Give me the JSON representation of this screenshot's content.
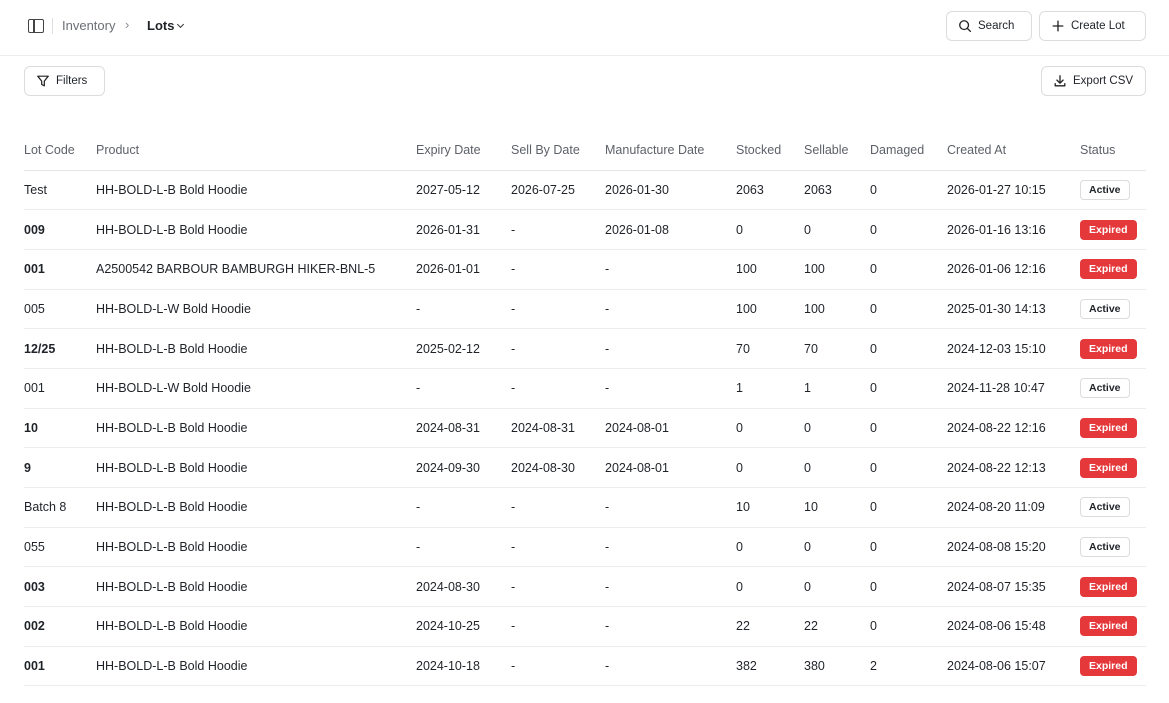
{
  "breadcrumb": {
    "parent": "Inventory",
    "current": "Lots"
  },
  "header_actions": {
    "search_label": "Search",
    "create_label": "Create Lot"
  },
  "toolbar": {
    "filters_label": "Filters",
    "export_label": "Export CSV"
  },
  "table": {
    "columns": [
      "Lot Code",
      "Product",
      "Expiry Date",
      "Sell By Date",
      "Manufacture Date",
      "Stocked",
      "Sellable",
      "Damaged",
      "Created At",
      "Status"
    ],
    "rows": [
      [
        "Test",
        "HH-BOLD-L-B Bold Hoodie",
        "2027-05-12",
        "2026-07-25",
        "2026-01-30",
        "2063",
        "2063",
        "0",
        "2026-01-27 10:15",
        "Active"
      ],
      [
        "009",
        "HH-BOLD-L-B Bold Hoodie",
        "2026-01-31",
        "-",
        "2026-01-08",
        "0",
        "0",
        "0",
        "2026-01-16 13:16",
        "Expired"
      ],
      [
        "001",
        "A2500542 BARBOUR BAMBURGH HIKER-BNL-5",
        "2026-01-01",
        "-",
        "-",
        "100",
        "100",
        "0",
        "2026-01-06 12:16",
        "Expired"
      ],
      [
        "005",
        "HH-BOLD-L-W Bold Hoodie",
        "-",
        "-",
        "-",
        "100",
        "100",
        "0",
        "2025-01-30 14:13",
        "Active"
      ],
      [
        "12/25",
        "HH-BOLD-L-B Bold Hoodie",
        "2025-02-12",
        "-",
        "-",
        "70",
        "70",
        "0",
        "2024-12-03 15:10",
        "Expired"
      ],
      [
        "001",
        "HH-BOLD-L-W Bold Hoodie",
        "-",
        "-",
        "-",
        "1",
        "1",
        "0",
        "2024-11-28 10:47",
        "Active"
      ],
      [
        "10",
        "HH-BOLD-L-B Bold Hoodie",
        "2024-08-31",
        "2024-08-31",
        "2024-08-01",
        "0",
        "0",
        "0",
        "2024-08-22 12:16",
        "Expired"
      ],
      [
        "9",
        "HH-BOLD-L-B Bold Hoodie",
        "2024-09-30",
        "2024-08-30",
        "2024-08-01",
        "0",
        "0",
        "0",
        "2024-08-22 12:13",
        "Expired"
      ],
      [
        "Batch 8",
        "HH-BOLD-L-B Bold Hoodie",
        "-",
        "-",
        "-",
        "10",
        "10",
        "0",
        "2024-08-20 11:09",
        "Active"
      ],
      [
        "055",
        "HH-BOLD-L-B Bold Hoodie",
        "-",
        "-",
        "-",
        "0",
        "0",
        "0",
        "2024-08-08 15:20",
        "Active"
      ],
      [
        "003",
        "HH-BOLD-L-B Bold Hoodie",
        "2024-08-30",
        "-",
        "-",
        "0",
        "0",
        "0",
        "2024-08-07 15:35",
        "Expired"
      ],
      [
        "002",
        "HH-BOLD-L-B Bold Hoodie",
        "2024-10-25",
        "-",
        "-",
        "22",
        "22",
        "0",
        "2024-08-06 15:48",
        "Expired"
      ],
      [
        "001",
        "HH-BOLD-L-B Bold Hoodie",
        "2024-10-18",
        "-",
        "-",
        "382",
        "380",
        "2",
        "2024-08-06 15:07",
        "Expired"
      ]
    ]
  },
  "colors": {
    "expired": "#e5383b",
    "border": "#dcdcdc",
    "muted_text": "#6b6f76"
  },
  "icons": {
    "sidebar": "sidebar-toggle-icon",
    "search": "search-icon",
    "create": "plus-icon",
    "filters": "filter-icon",
    "export": "download-icon"
  }
}
